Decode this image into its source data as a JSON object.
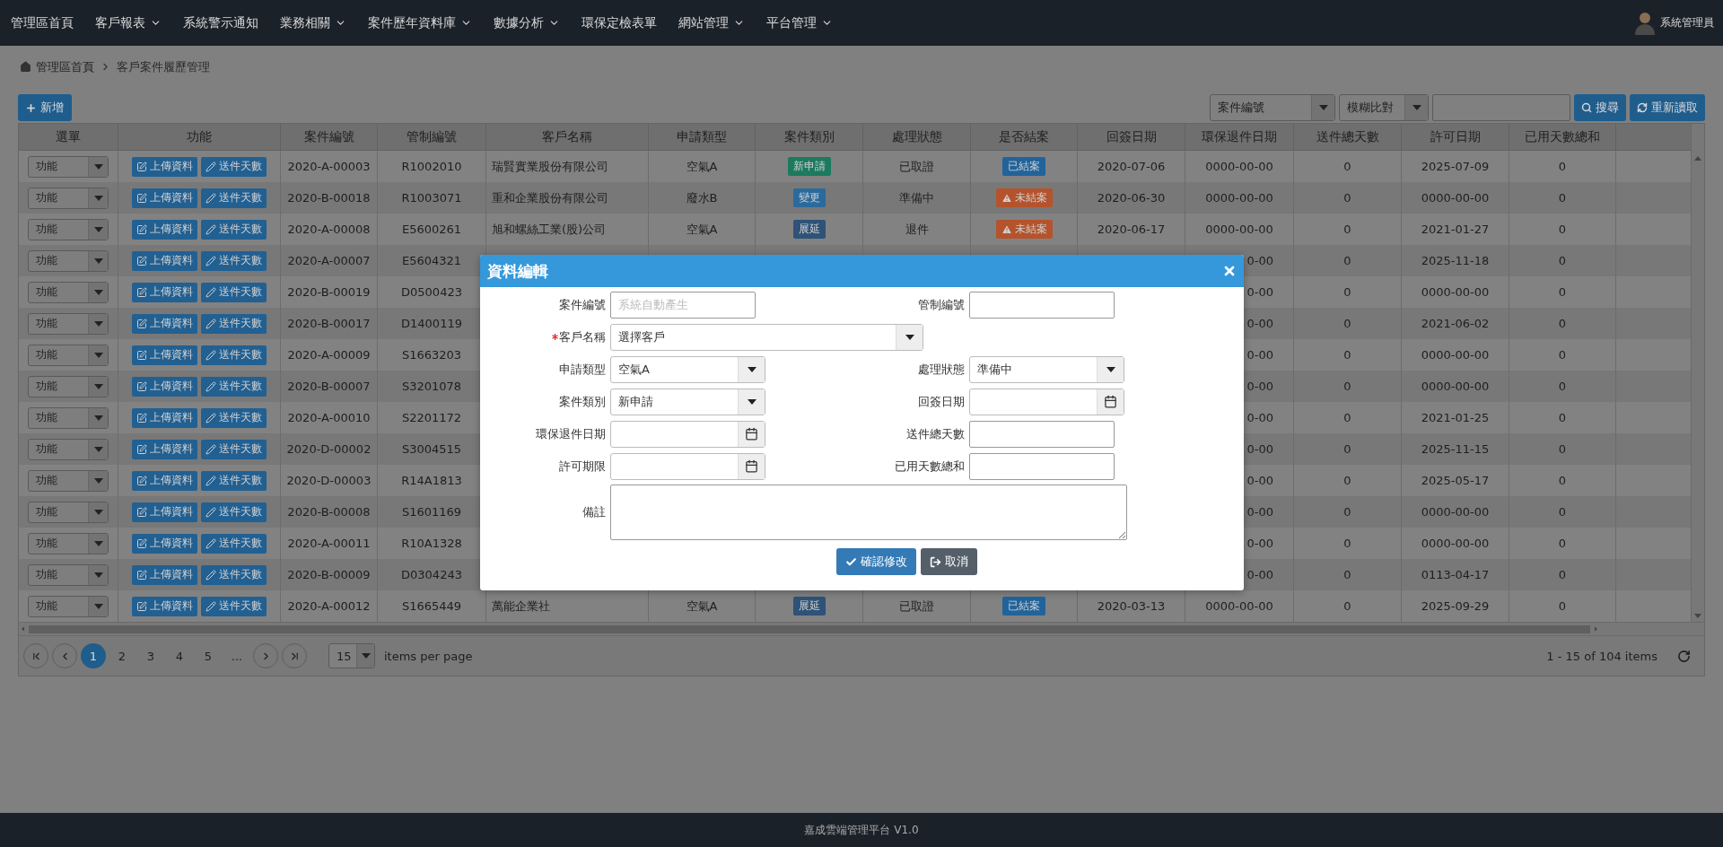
{
  "nav": {
    "items": [
      {
        "label": "管理區首頁",
        "dropdown": false
      },
      {
        "label": "客戶報表",
        "dropdown": true
      },
      {
        "label": "系統警示通知",
        "dropdown": false
      },
      {
        "label": "業務相關",
        "dropdown": true
      },
      {
        "label": "案件歷年資料庫",
        "dropdown": true
      },
      {
        "label": "數據分析",
        "dropdown": true
      },
      {
        "label": "環保定檢表單",
        "dropdown": false
      },
      {
        "label": "網站管理",
        "dropdown": true
      },
      {
        "label": "平台管理",
        "dropdown": true
      }
    ],
    "user": "系統管理員"
  },
  "breadcrumb": [
    "管理區首頁",
    "客戶案件履歷管理"
  ],
  "toolbar": {
    "add": "新增",
    "search_field": "案件編號",
    "match_mode": "模糊比對",
    "search": "搜尋",
    "reload": "重新讀取"
  },
  "table": {
    "columns": [
      "選單",
      "功能",
      "案件編號",
      "管制編號",
      "客戶名稱",
      "申請類型",
      "案件類別",
      "處理狀態",
      "是否結案",
      "回簽日期",
      "環保退件日期",
      "送件總天數",
      "許可日期",
      "已用天數總和"
    ],
    "rows": [
      {
        "menu": "功能",
        "actions": [
          "上傳資料",
          "送件天數"
        ],
        "case_no": "2020-A-00003",
        "control_no": "R1002010",
        "covered": false,
        "customer": "瑞賢實業股份有限公司",
        "apply_type": "空氣A",
        "category": {
          "label": "新申請",
          "color": "#1c7a5e"
        },
        "status": "已取證",
        "closed": {
          "label": "已結案",
          "color": "#21639a",
          "warning": false
        },
        "sign_date": "2020-07-06",
        "return_date": "0000-00-00",
        "total_days": "0",
        "permit_date": "2025-07-09",
        "used_days": "0"
      },
      {
        "menu": "功能",
        "actions": [
          "上傳資料",
          "送件天數"
        ],
        "case_no": "2020-B-00018",
        "control_no": "R1003071",
        "covered": false,
        "customer": "重和企業股份有限公司",
        "apply_type": "廢水B",
        "category": {
          "label": "變更",
          "color": "#2a6a9c"
        },
        "status": "準備中",
        "closed": {
          "label": "未結案",
          "color": "#b4532c",
          "warning": true
        },
        "sign_date": "2020-06-30",
        "return_date": "0000-00-00",
        "total_days": "0",
        "permit_date": "0000-00-00",
        "used_days": "0"
      },
      {
        "menu": "功能",
        "actions": [
          "上傳資料",
          "送件天數"
        ],
        "case_no": "2020-A-00008",
        "control_no": "E5600261",
        "covered": false,
        "customer": "旭和螺絲工業(股)公司",
        "apply_type": "空氣A",
        "category": {
          "label": "展延",
          "color": "#2f5278"
        },
        "status": "退件",
        "closed": {
          "label": "未結案",
          "color": "#b4532c",
          "warning": true
        },
        "sign_date": "2020-06-17",
        "return_date": "0000-00-00",
        "total_days": "0",
        "permit_date": "2021-01-27",
        "used_days": "0"
      },
      {
        "menu": "功能",
        "actions": [
          "上傳資料",
          "送件天數"
        ],
        "case_no": "2020-A-00007",
        "control_no": "E5604321",
        "covered": true,
        "return_date": "0-00",
        "total_days": "0",
        "permit_date": "2025-11-18",
        "used_days": "0"
      },
      {
        "menu": "功能",
        "actions": [
          "上傳資料",
          "送件天數"
        ],
        "case_no": "2020-B-00019",
        "control_no": "D0500423",
        "covered": true,
        "return_date": "0-00",
        "total_days": "0",
        "permit_date": "0000-00-00",
        "used_days": "0"
      },
      {
        "menu": "功能",
        "actions": [
          "上傳資料",
          "送件天數"
        ],
        "case_no": "2020-B-00017",
        "control_no": "D1400119",
        "covered": true,
        "return_date": "0-00",
        "total_days": "0",
        "permit_date": "2021-06-02",
        "used_days": "0"
      },
      {
        "menu": "功能",
        "actions": [
          "上傳資料",
          "送件天數"
        ],
        "case_no": "2020-A-00009",
        "control_no": "S1663203",
        "covered": true,
        "return_date": "0-00",
        "total_days": "0",
        "permit_date": "0000-00-00",
        "used_days": "0"
      },
      {
        "menu": "功能",
        "actions": [
          "上傳資料",
          "送件天數"
        ],
        "case_no": "2020-B-00007",
        "control_no": "S3201078",
        "covered": true,
        "return_date": "0-00",
        "total_days": "0",
        "permit_date": "0000-00-00",
        "used_days": "0"
      },
      {
        "menu": "功能",
        "actions": [
          "上傳資料",
          "送件天數"
        ],
        "case_no": "2020-A-00010",
        "control_no": "S2201172",
        "covered": true,
        "return_date": "0-00",
        "total_days": "0",
        "permit_date": "2021-01-25",
        "used_days": "0"
      },
      {
        "menu": "功能",
        "actions": [
          "上傳資料",
          "送件天數"
        ],
        "case_no": "2020-D-00002",
        "control_no": "S3004515",
        "covered": true,
        "return_date": "0-00",
        "total_days": "0",
        "permit_date": "2025-11-15",
        "used_days": "0"
      },
      {
        "menu": "功能",
        "actions": [
          "上傳資料",
          "送件天數"
        ],
        "case_no": "2020-D-00003",
        "control_no": "R14A1813",
        "covered": true,
        "return_date": "0-00",
        "total_days": "0",
        "permit_date": "2025-05-17",
        "used_days": "0"
      },
      {
        "menu": "功能",
        "actions": [
          "上傳資料",
          "送件天數"
        ],
        "case_no": "2020-B-00008",
        "control_no": "S1601169",
        "covered": true,
        "return_date": "0-00",
        "total_days": "0",
        "permit_date": "0000-00-00",
        "used_days": "0"
      },
      {
        "menu": "功能",
        "actions": [
          "上傳資料",
          "送件天數"
        ],
        "case_no": "2020-A-00011",
        "control_no": "R10A1328",
        "covered": true,
        "return_date": "0-00",
        "total_days": "0",
        "permit_date": "0000-00-00",
        "used_days": "0"
      },
      {
        "menu": "功能",
        "actions": [
          "上傳資料",
          "送件天數"
        ],
        "case_no": "2020-B-00009",
        "control_no": "D0304243",
        "covered": true,
        "return_date": "0-00",
        "total_days": "0",
        "permit_date": "0113-04-17",
        "used_days": "0"
      },
      {
        "menu": "功能",
        "actions": [
          "上傳資料",
          "送件天數"
        ],
        "case_no": "2020-A-00012",
        "control_no": "S1665449",
        "covered": false,
        "customer": "萬能企業社",
        "apply_type": "空氣A",
        "category": {
          "label": "展延",
          "color": "#2f5278"
        },
        "status": "已取證",
        "closed": {
          "label": "已結案",
          "color": "#21639a",
          "warning": false
        },
        "sign_date": "2020-03-13",
        "return_date": "0000-00-00",
        "total_days": "0",
        "permit_date": "2025-09-29",
        "used_days": "0"
      }
    ]
  },
  "pager": {
    "pages": [
      {
        "label": "1",
        "selected": true
      },
      {
        "label": "2",
        "selected": false
      },
      {
        "label": "3",
        "selected": false
      },
      {
        "label": "4",
        "selected": false
      },
      {
        "label": "5",
        "selected": false
      },
      {
        "label": "...",
        "selected": false
      }
    ],
    "page_size": "15",
    "page_size_label": "items per page",
    "summary": "1 - 15 of 104 items"
  },
  "modal": {
    "title": "資料編輯",
    "rows": [
      {
        "fields": [
          {
            "kind": "text",
            "label": "案件編號",
            "required": false,
            "placeholder": "系統自動產生"
          },
          {
            "kind": "text",
            "label": "管制編號",
            "required": false
          }
        ]
      },
      {
        "fields": [
          {
            "kind": "wide-select",
            "label": "客戶名稱",
            "required": true,
            "value": "選擇客戶"
          }
        ]
      },
      {
        "fields": [
          {
            "kind": "select",
            "label": "申請類型",
            "required": false,
            "value": "空氣A"
          },
          {
            "kind": "select",
            "label": "處理狀態",
            "required": false,
            "value": "準備中"
          }
        ]
      },
      {
        "fields": [
          {
            "kind": "select",
            "label": "案件類別",
            "required": false,
            "value": "新申請"
          },
          {
            "kind": "date",
            "label": "回簽日期",
            "required": false
          }
        ]
      },
      {
        "fields": [
          {
            "kind": "date",
            "label": "環保退件日期",
            "required": false
          },
          {
            "kind": "text",
            "label": "送件總天數",
            "required": false
          }
        ]
      },
      {
        "fields": [
          {
            "kind": "date",
            "label": "許可期限",
            "required": false
          },
          {
            "kind": "text",
            "label": "已用天數總和",
            "required": false
          }
        ]
      },
      {
        "fields": [
          {
            "kind": "textarea",
            "label": "備註",
            "required": false
          }
        ]
      }
    ],
    "buttons": [
      {
        "kind": "confirm",
        "label": "確認修改"
      },
      {
        "kind": "cancel",
        "label": "取消"
      }
    ]
  },
  "footer": "嘉成雲端管理平台 V1.0"
}
